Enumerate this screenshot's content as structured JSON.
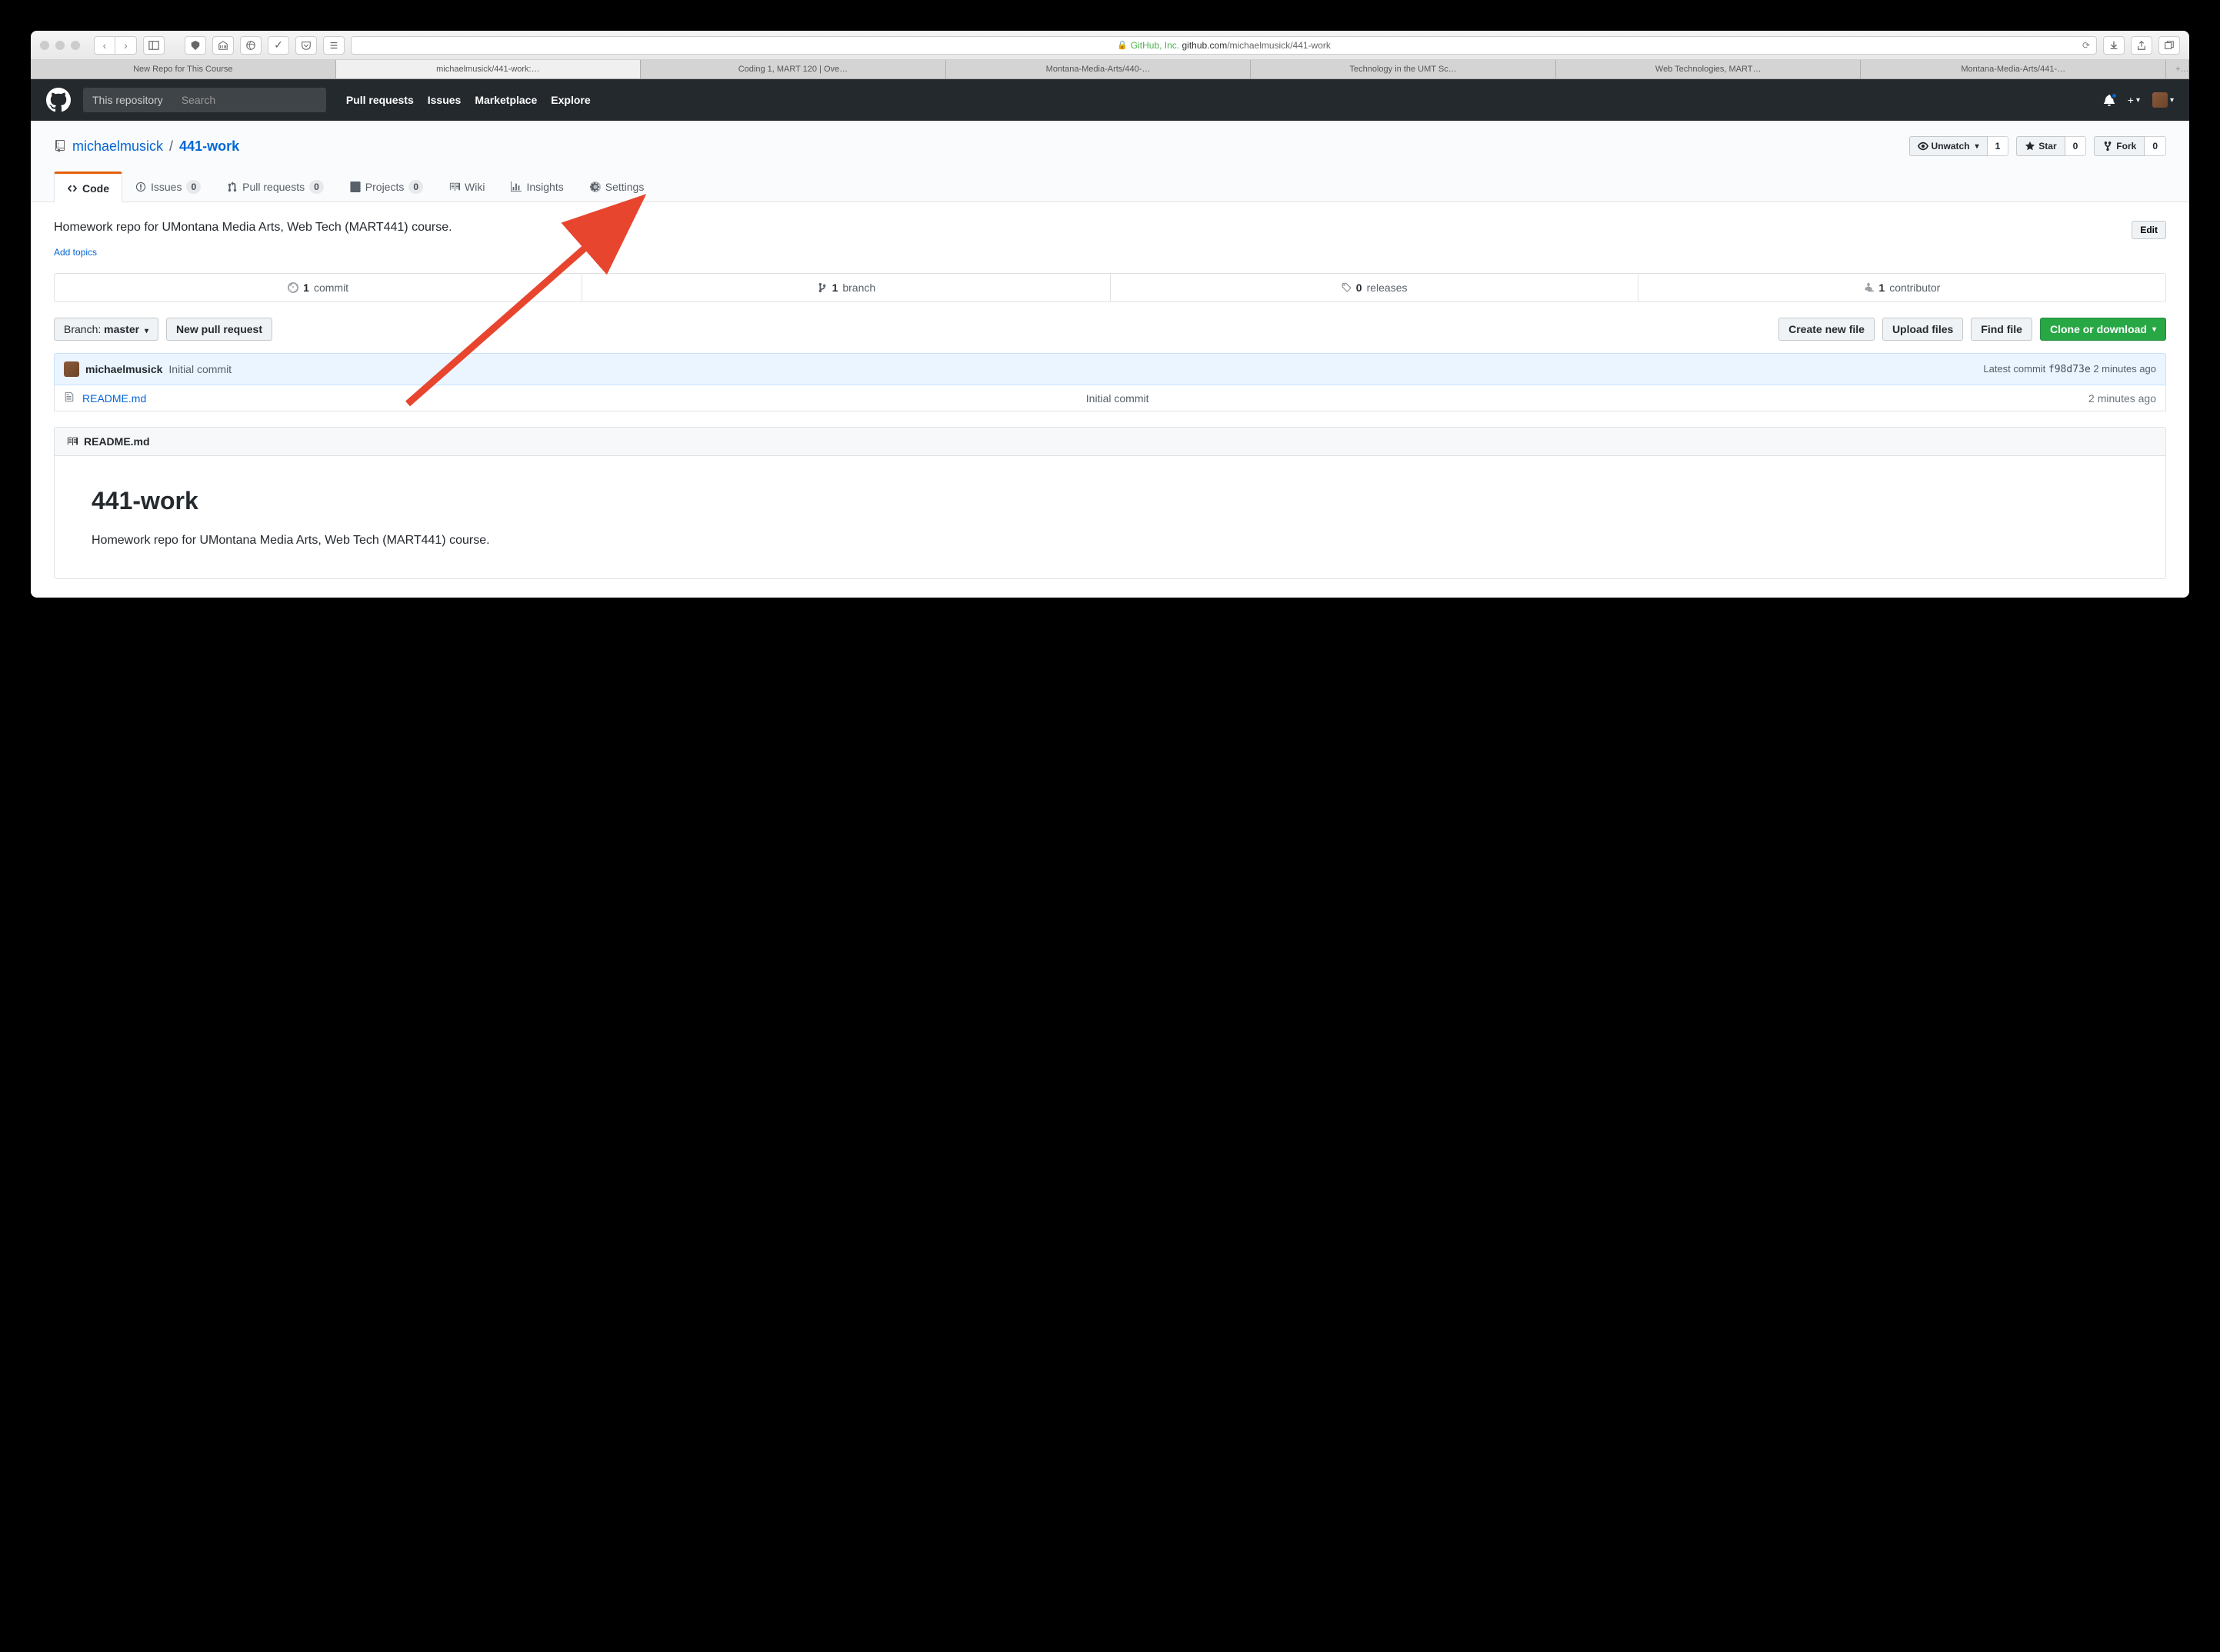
{
  "browser": {
    "url_org": "GitHub, Inc.",
    "url_host": "github.com",
    "url_path": "/michaelmusick/441-work",
    "tabs": [
      "New Repo for This Course",
      "michaelmusick/441-work:…",
      "Coding 1, MART 120 | Ove…",
      "Montana-Media-Arts/440-…",
      "Technology in the UMT Sc…",
      "Web Technologies, MART…",
      "Montana-Media-Arts/441-…"
    ],
    "active_tab": 1
  },
  "header": {
    "search_scope": "This repository",
    "search_placeholder": "Search",
    "nav": [
      "Pull requests",
      "Issues",
      "Marketplace",
      "Explore"
    ]
  },
  "repo": {
    "owner": "michaelmusick",
    "name": "441-work",
    "actions": {
      "unwatch": "Unwatch",
      "unwatch_count": "1",
      "star": "Star",
      "star_count": "0",
      "fork": "Fork",
      "fork_count": "0"
    },
    "tabs": {
      "code": "Code",
      "issues": "Issues",
      "issues_count": "0",
      "pulls": "Pull requests",
      "pulls_count": "0",
      "projects": "Projects",
      "projects_count": "0",
      "wiki": "Wiki",
      "insights": "Insights",
      "settings": "Settings"
    },
    "description": "Homework repo for UMontana Media Arts, Web Tech (MART441) course.",
    "edit": "Edit",
    "add_topics": "Add topics",
    "stats": {
      "commits_n": "1",
      "commits": "commit",
      "branches_n": "1",
      "branches": "branch",
      "releases_n": "0",
      "releases": "releases",
      "contributors_n": "1",
      "contributors": "contributor"
    },
    "file_nav": {
      "branch_label": "Branch:",
      "branch": "master",
      "new_pr": "New pull request",
      "create_file": "Create new file",
      "upload": "Upload files",
      "find": "Find file",
      "clone": "Clone or download"
    },
    "commit": {
      "author": "michaelmusick",
      "message": "Initial commit",
      "latest_label": "Latest commit",
      "sha": "f98d73e",
      "time": "2 minutes ago"
    },
    "files": [
      {
        "name": "README.md",
        "msg": "Initial commit",
        "time": "2 minutes ago"
      }
    ],
    "readme": {
      "filename": "README.md",
      "title": "441-work",
      "body": "Homework repo for UMontana Media Arts, Web Tech (MART441) course."
    }
  }
}
